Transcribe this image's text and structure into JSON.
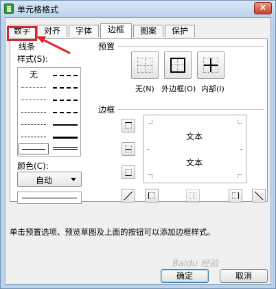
{
  "window": {
    "title": "单元格格式",
    "close_glyph": "×"
  },
  "tabs": [
    {
      "label": "数字"
    },
    {
      "label": "对齐"
    },
    {
      "label": "字体"
    },
    {
      "label": "边框"
    },
    {
      "label": "图案"
    },
    {
      "label": "保护"
    }
  ],
  "active_tab": "边框",
  "line_group": {
    "title": "线条",
    "style_label": "样式(S):",
    "none_label": "无",
    "color_label": "颜色(C):",
    "color_value": "自动"
  },
  "presets": {
    "title": "预置",
    "items": [
      {
        "label": "无(N)",
        "icon": "preset-none-icon"
      },
      {
        "label": "外边框(O)",
        "icon": "preset-outline-icon"
      },
      {
        "label": "内部(I)",
        "icon": "preset-inside-icon"
      }
    ]
  },
  "border": {
    "title": "边框",
    "preview_text_top": "文本",
    "preview_text_bottom": "文本"
  },
  "hint": "单击预置选项、预览草图及上面的按钮可以添加边框样式。",
  "buttons": {
    "ok": "确定",
    "cancel": "取消"
  },
  "colors": {
    "highlight": "#d9262c",
    "dialog_bg": "#f0f0f0",
    "title_bar": "#bcd3ec"
  },
  "watermark": "Baidu 经验"
}
